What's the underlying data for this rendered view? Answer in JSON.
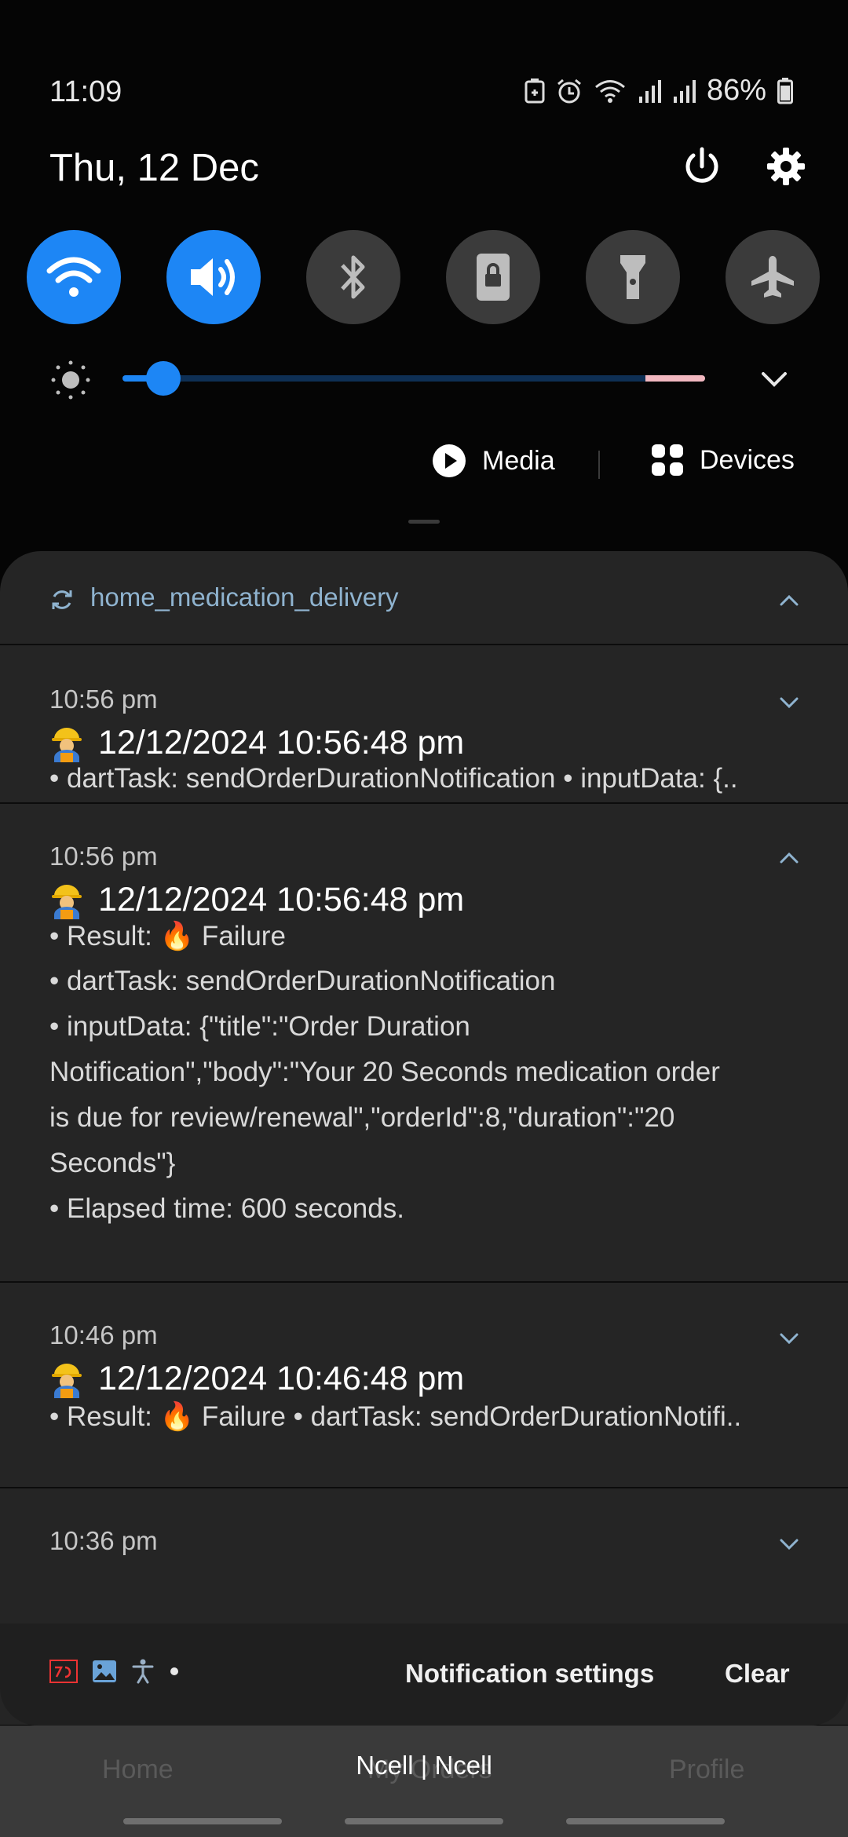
{
  "status_bar": {
    "time": "11:09",
    "battery": "86%",
    "icons": [
      "battery-saver-icon",
      "alarm-icon",
      "wifi-icon",
      "signal-icon",
      "signal-icon",
      "battery-icon"
    ]
  },
  "header": {
    "date": "Thu, 12 Dec"
  },
  "quick_toggles": [
    {
      "name": "wifi",
      "state": "on"
    },
    {
      "name": "sound",
      "state": "on"
    },
    {
      "name": "bluetooth",
      "state": "off"
    },
    {
      "name": "screen-lock",
      "state": "off"
    },
    {
      "name": "flashlight",
      "state": "off"
    },
    {
      "name": "airplane-mode",
      "state": "off"
    }
  ],
  "brightness": {
    "level": 0.07
  },
  "media_row": {
    "media_label": "Media",
    "devices_label": "Devices"
  },
  "notification_group": {
    "app_name": "home_medication_delivery",
    "notifications": [
      {
        "time": "10:56 pm",
        "title": "12/12/2024 10:56:48 pm",
        "lines": [
          "• dartTask: sendOrderDurationNotification • inputData: {.."
        ],
        "expanded": false
      },
      {
        "time": "10:56 pm",
        "title": "12/12/2024 10:56:48 pm",
        "lines": [
          "• Result: 🔥 Failure",
          "• dartTask: sendOrderDurationNotification",
          "• inputData: {\"title\":\"Order Duration",
          "Notification\",\"body\":\"Your 20 Seconds medication order",
          "is due for review/renewal\",\"orderId\":8,\"duration\":\"20",
          "Seconds\"}",
          "• Elapsed time: 600 seconds."
        ],
        "expanded": true
      },
      {
        "time": "10:46 pm",
        "title": "12/12/2024 10:46:48 pm",
        "lines": [
          "• Result: 🔥 Failure • dartTask: sendOrderDurationNotifi.."
        ],
        "expanded": false
      },
      {
        "time": "10:36 pm",
        "expanded": false
      }
    ]
  },
  "panel_footer": {
    "settings_label": "Notification settings",
    "clear_label": "Clear"
  },
  "background_app": {
    "tabs": [
      "Home",
      "My Orders",
      "Profile"
    ],
    "carrier": "Ncell | Ncell"
  },
  "colors": {
    "accent": "#1d86f5",
    "panel": "#252525",
    "app_name": "#8fb3cf"
  }
}
